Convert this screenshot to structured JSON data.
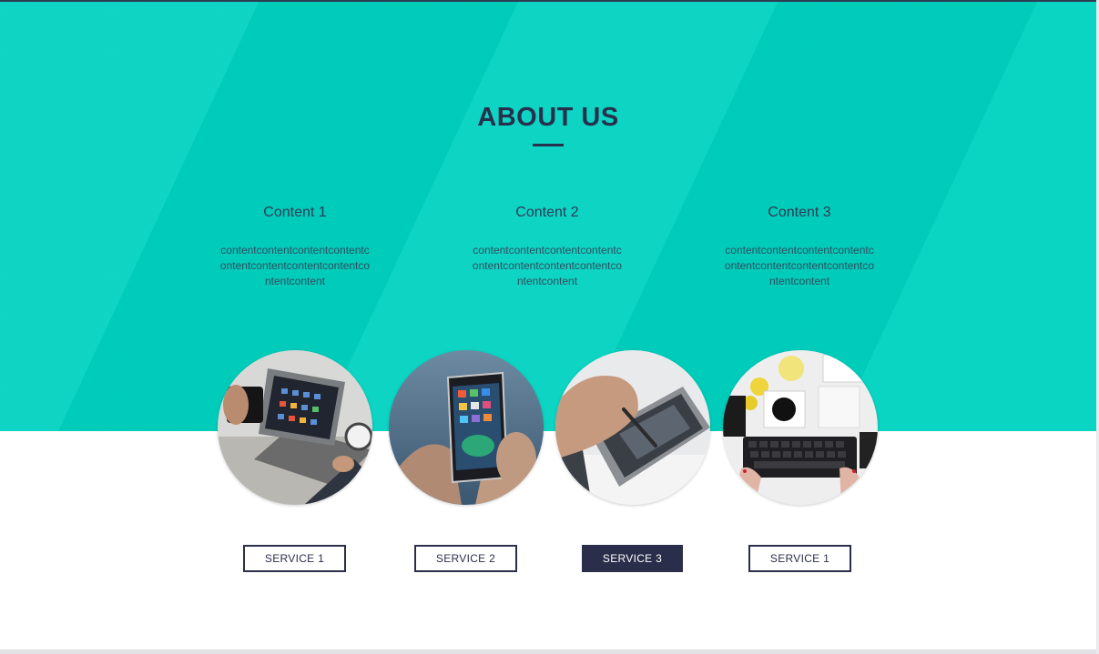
{
  "section": {
    "title": "ABOUT US",
    "accent_color": "#00d2c0",
    "dark_color": "#2b2e4a"
  },
  "columns": [
    {
      "heading": "Content 1",
      "text": "contentcontentcontentcontentcontentcontentcontentcontentcontentcontent"
    },
    {
      "heading": "Content 2",
      "text": "contentcontentcontentcontentcontentcontentcontentcontentcontentcontent"
    },
    {
      "heading": "Content 3",
      "text": "contentcontentcontentcontentcontentcontentcontentcontentcontentcontent"
    }
  ],
  "images": [
    {
      "icon": "tablet-photo"
    },
    {
      "icon": "smartphone-photo"
    },
    {
      "icon": "stylus-tablet-photo"
    },
    {
      "icon": "keyboard-desk-photo"
    }
  ],
  "services": [
    {
      "label": "SERVICE 1",
      "active": false
    },
    {
      "label": "SERVICE 2",
      "active": false
    },
    {
      "label": "SERVICE 3",
      "active": true
    },
    {
      "label": "SERVICE 1",
      "active": false
    }
  ]
}
